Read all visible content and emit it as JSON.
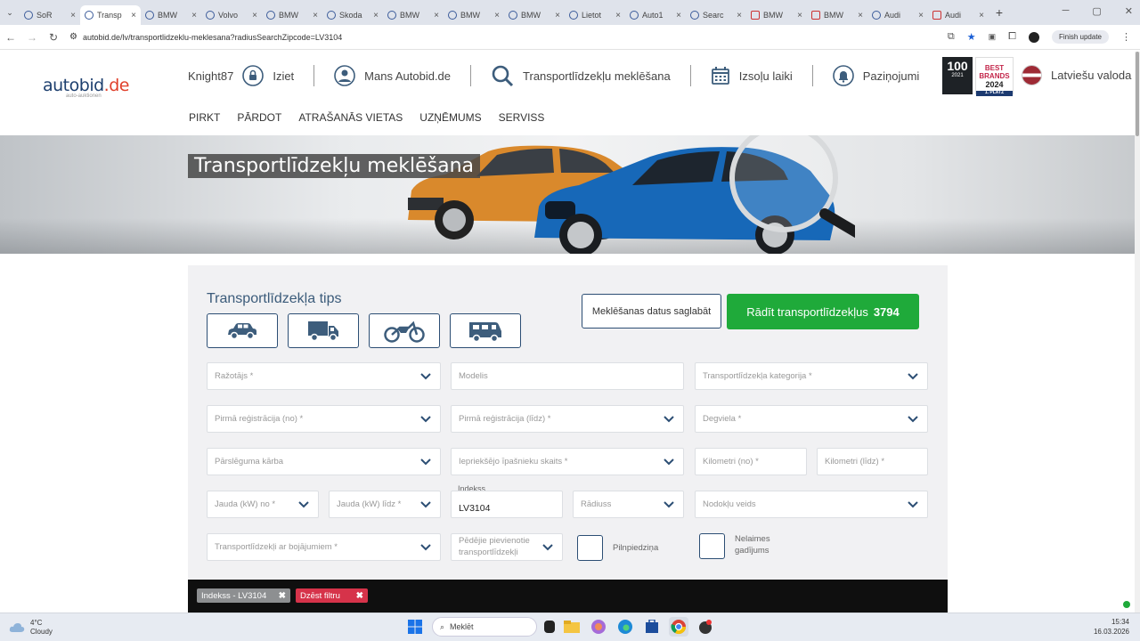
{
  "browser": {
    "tabs": [
      {
        "label": "SoR",
        "active": false,
        "icon": "globe-icon"
      },
      {
        "label": "Transp",
        "active": true,
        "icon": "autobid-icon"
      },
      {
        "label": "BMW",
        "active": false,
        "icon": "autobid-icon"
      },
      {
        "label": "Volvo",
        "active": false,
        "icon": "autobid-icon"
      },
      {
        "label": "BMW",
        "active": false,
        "icon": "autobid-icon"
      },
      {
        "label": "Skoda",
        "active": false,
        "icon": "autobid-icon"
      },
      {
        "label": "BMW",
        "active": false,
        "icon": "autobid-icon"
      },
      {
        "label": "BMW",
        "active": false,
        "icon": "autobid-icon"
      },
      {
        "label": "BMW",
        "active": false,
        "icon": "autobid-icon"
      },
      {
        "label": "Lietot",
        "active": false,
        "icon": "globe-icon"
      },
      {
        "label": "Auto1",
        "active": false,
        "icon": "flag-icon"
      },
      {
        "label": "Searc",
        "active": false,
        "icon": "flag-icon"
      },
      {
        "label": "BMW",
        "active": false,
        "icon": "red-icon"
      },
      {
        "label": "BMW",
        "active": false,
        "icon": "red-icon"
      },
      {
        "label": "Audi",
        "active": false,
        "icon": "flag-icon"
      },
      {
        "label": "Audi",
        "active": false,
        "icon": "red-icon"
      }
    ],
    "url": "autobid.de/lv/transportlidzeklu-meklesana?radiusSearchZipcode=LV3104",
    "update_label": "Finish update"
  },
  "header": {
    "user": "Knight87",
    "logout": "Iziet",
    "my_autobid": "Mans Autobid.de",
    "vehicle_search": "Transportlīdzekļu meklēšana",
    "auction_times": "Izsoļu laiki",
    "notifications": "Paziņojumi",
    "language": "Latviešu valoda",
    "badge1": {
      "top": "",
      "big": "100",
      "bottom": "2021"
    },
    "badge2": {
      "line1": "BEST",
      "line2": "BRANDS",
      "year": "2024",
      "place": "1. PLATZ"
    }
  },
  "logo": {
    "text": "autobid",
    "tld": ".de",
    "sub": "auto-auktionen"
  },
  "mainnav": [
    "PIRKT",
    "PĀRDOT",
    "ATRAŠANĀS VIETAS",
    "UZŅĒMUMS",
    "SERVISS"
  ],
  "hero": {
    "title": "Transportlīdzekļu meklēšana"
  },
  "search": {
    "type_title": "Transportlīdzekļa tips",
    "save_label": "Meklēšanas datus saglabāt",
    "show_label": "Rādīt transportlīdzekļus",
    "count": "3794",
    "fields": {
      "manufacturer": "Ražotājs *",
      "model": "Modelis",
      "category": "Transportlīdzekļa kategorija *",
      "first_reg_from": "Pirmā reģistrācija (no) *",
      "first_reg_to": "Pirmā reģistrācija (līdz) *",
      "fuel": "Degviela *",
      "gearbox": "Pārslēguma kārba",
      "owners": "Iepriekšējo īpašnieku skaits *",
      "km_from": "Kilometri (no) *",
      "km_to": "Kilometri (līdz) *",
      "power_from": "Jauda (kW) no *",
      "power_to": "Jauda (kW) līdz *",
      "zip_label": "Indekss",
      "zip_value": "LV3104",
      "radius": "Rādiuss",
      "tax": "Nodokļu veids",
      "damaged": "Transportlīdzekļi ar bojājumiem *",
      "last_added": [
        "Pēdējie pievienotie",
        "transportlīdzekļi"
      ],
      "full_power": "Pilnpiedziņa",
      "accident_free": [
        "Nelaimes",
        "gadījums"
      ]
    }
  },
  "filters": [
    {
      "label": "Indekss - LV3104",
      "color": "#8d8f91"
    },
    {
      "label": "Dzēst filtru",
      "color": "#d6334a"
    }
  ],
  "taskbar": {
    "temp": "4°C",
    "weather": "Cloudy",
    "search_placeholder": "Meklēt",
    "time": "15:34",
    "date": "16.03.2026"
  }
}
